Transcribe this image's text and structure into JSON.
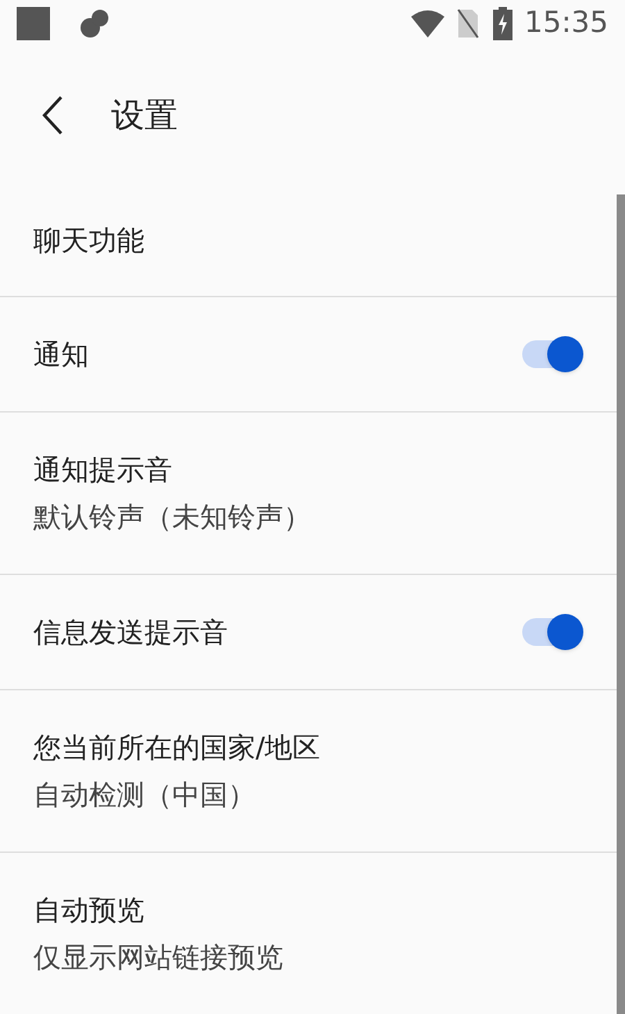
{
  "status_bar": {
    "time": "15:35"
  },
  "header": {
    "title": "设置"
  },
  "items": [
    {
      "kind": "plain",
      "title": "聊天功能"
    },
    {
      "kind": "toggle",
      "title": "通知",
      "on": true
    },
    {
      "kind": "subtitle",
      "title": "通知提示音",
      "subtitle": "默认铃声（未知铃声）"
    },
    {
      "kind": "toggle",
      "title": "信息发送提示音",
      "on": true
    },
    {
      "kind": "subtitle",
      "title": "您当前所在的国家/地区",
      "subtitle": "自动检测（中国）"
    },
    {
      "kind": "subtitle",
      "title": "自动预览",
      "subtitle": "仅显示网站链接预览"
    }
  ]
}
